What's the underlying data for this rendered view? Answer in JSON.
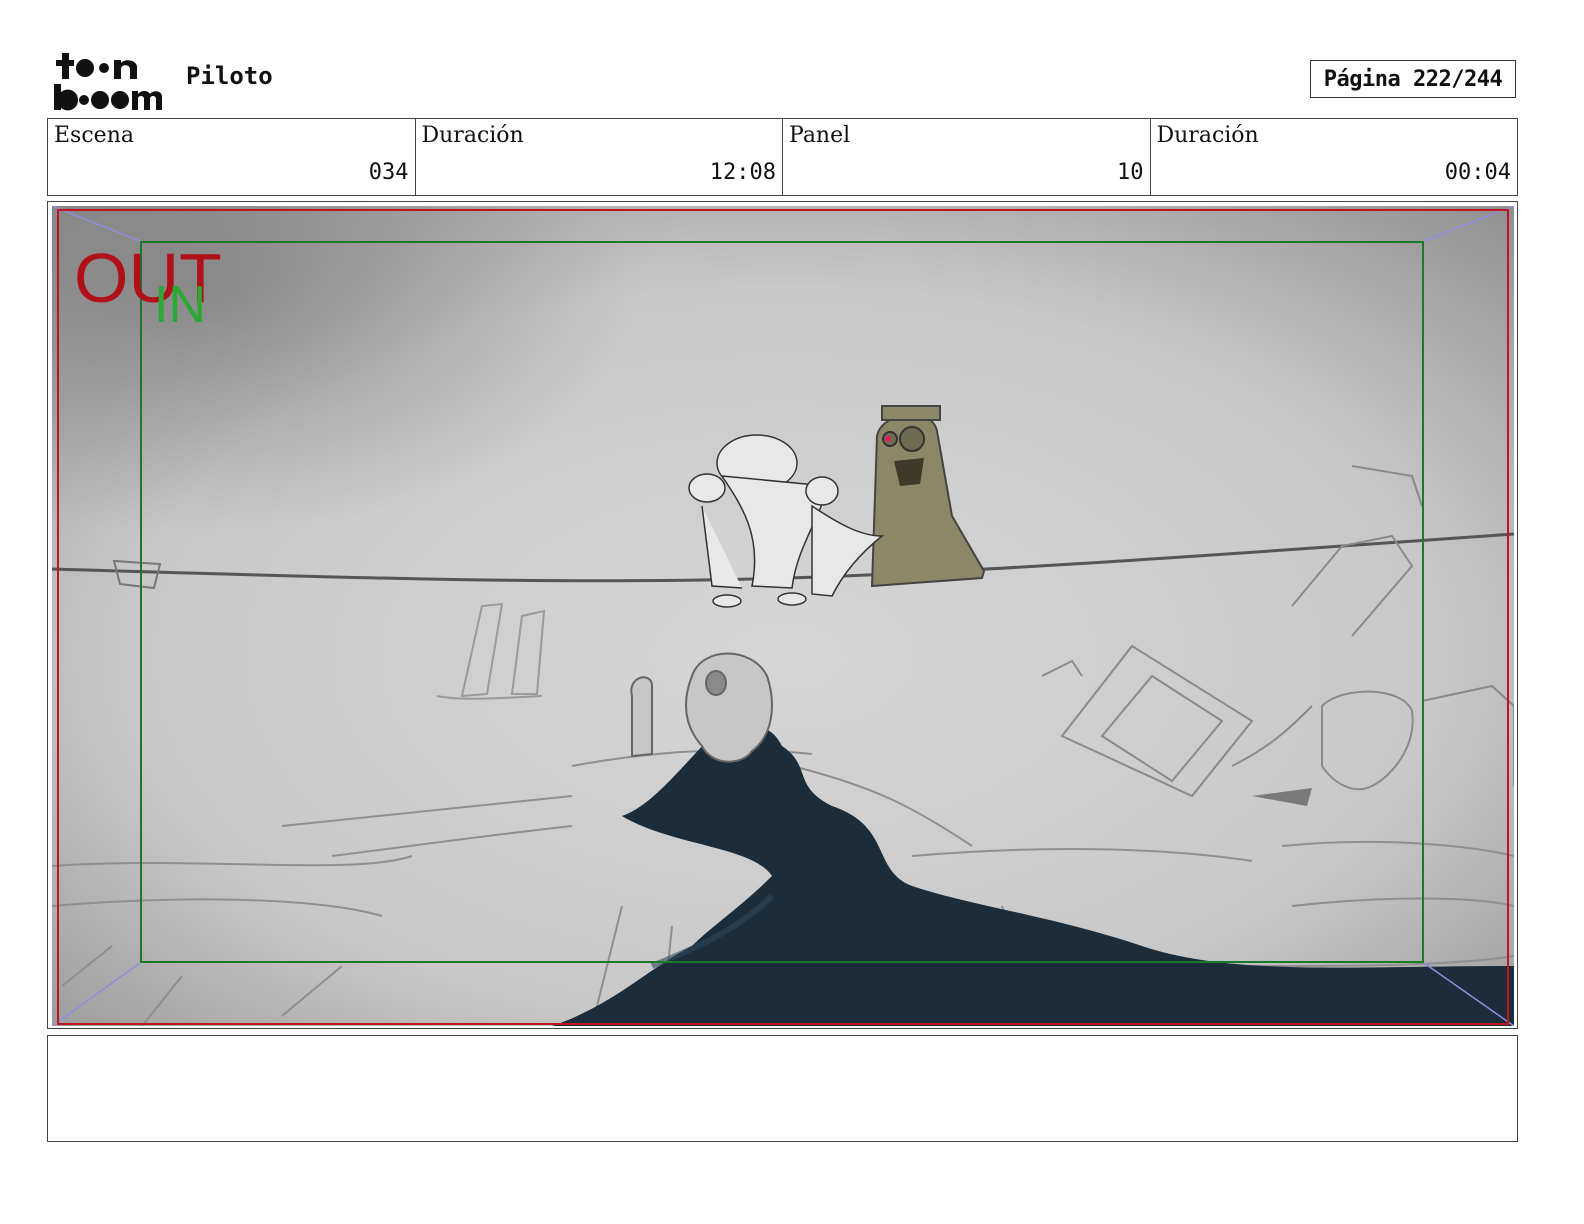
{
  "header": {
    "logo_text": "toon boom",
    "project_title": "Piloto",
    "page_label": "Página",
    "page_value": "222/244"
  },
  "info": [
    {
      "label": "Escena",
      "value": "034"
    },
    {
      "label": "Duración",
      "value": "12:08"
    },
    {
      "label": "Panel",
      "value": "10"
    },
    {
      "label": "Duración",
      "value": "00:04"
    }
  ],
  "panel": {
    "out_marker": "OUT",
    "in_marker": "IN",
    "colors": {
      "out_frame": "#c0141e",
      "in_frame": "#1a8a2a",
      "background": "#cfcfcf",
      "river": "#1a2b3a",
      "statue": "#8c8766"
    }
  },
  "notes": {
    "text": ""
  }
}
